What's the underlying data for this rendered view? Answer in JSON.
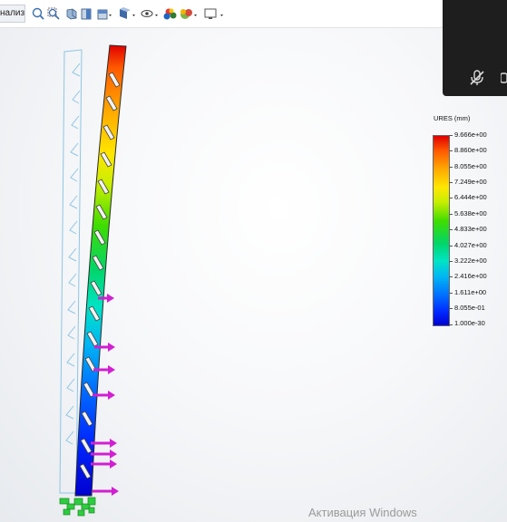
{
  "toolbar": {
    "tab_label": "нализа",
    "icons": [
      "zoom-to-fit-icon",
      "zoom-to-area-icon",
      "previous-view-icon",
      "section-view-icon",
      "view-orientation-icon",
      "display-style-icon",
      "hide-show-items-icon",
      "edit-appearance-icon",
      "apply-scene-icon",
      "view-settings-icon"
    ]
  },
  "legend": {
    "title": "URES (mm)",
    "values": [
      "9.666e+00",
      "8.860e+00",
      "8.055e+00",
      "7.249e+00",
      "6.444e+00",
      "5.638e+00",
      "4.833e+00",
      "4.027e+00",
      "3.222e+00",
      "2.416e+00",
      "1.611e+00",
      "8.055e-01",
      "1.000e-30"
    ],
    "colors": [
      "#e00000",
      "#ffa500",
      "#ffe600",
      "#3fdc00",
      "#00e4c5",
      "#0070ff",
      "#0000d0"
    ]
  },
  "overlay": {
    "mic_icon": "mic-muted-icon"
  },
  "watermark": {
    "text": "Активация Windows"
  }
}
